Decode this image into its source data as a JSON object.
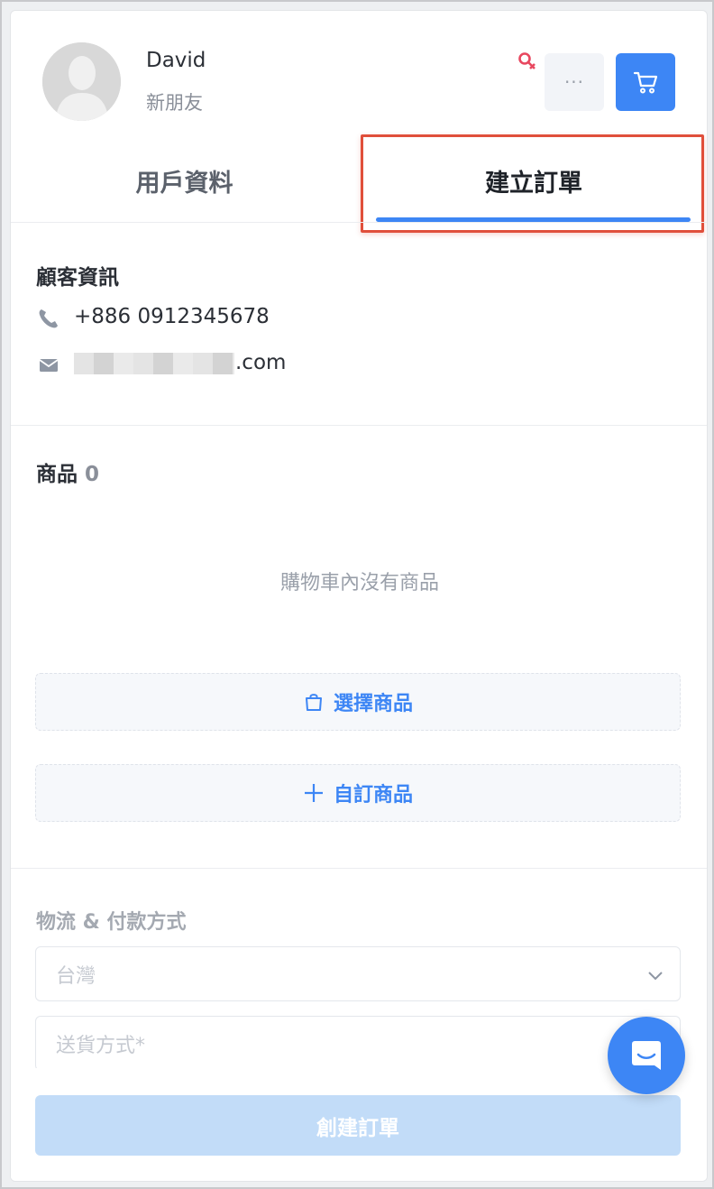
{
  "customer": {
    "name": "David",
    "tag": "新朋友"
  },
  "header": {
    "more_label": "···"
  },
  "tabs": [
    {
      "label": "用戶資料",
      "active": false
    },
    {
      "label": "建立訂單",
      "active": true
    }
  ],
  "customer_info": {
    "title": "顧客資訊",
    "phone": "+886 0912345678",
    "email_suffix": ".com"
  },
  "products": {
    "title": "商品",
    "count": "0",
    "empty_message": "購物車內沒有商品",
    "select_label": "選擇商品",
    "custom_label": "自訂商品"
  },
  "shipping": {
    "title": "物流 & 付款方式",
    "country_value": "台灣",
    "delivery_placeholder": "送貨方式*"
  },
  "submit_label": "創建訂單",
  "colors": {
    "accent": "#3d86f5",
    "highlight_border": "#e04f3b",
    "gender_icon": "#e8475f"
  }
}
